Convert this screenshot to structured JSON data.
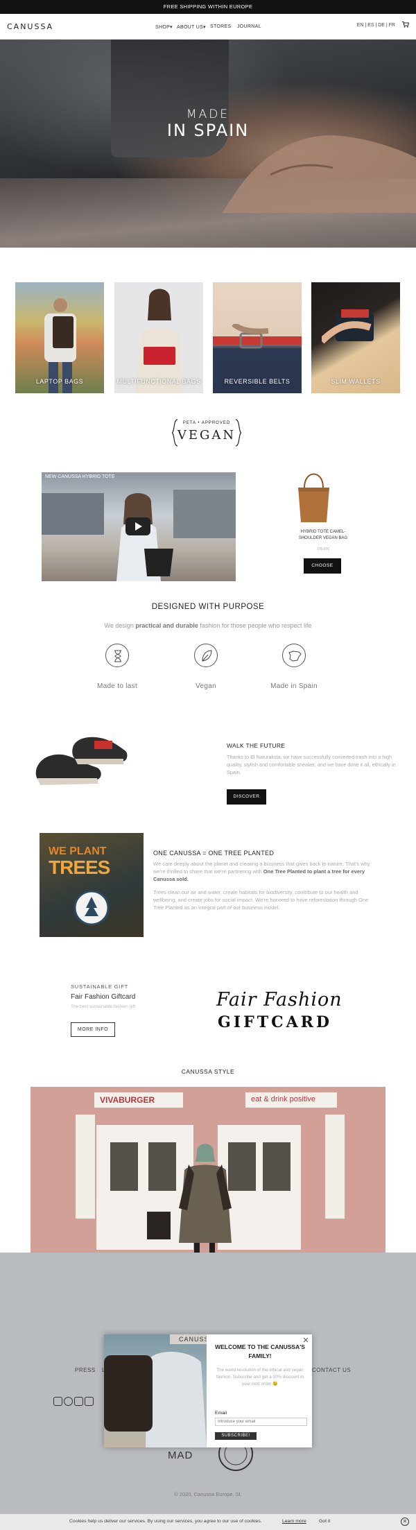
{
  "topbar": {
    "text": "FREE SHIPPING WITHIN EUROPE"
  },
  "header": {
    "logo": "CANUSSA",
    "nav": [
      "SHOP▾",
      "ABOUT US▾",
      "STORES",
      "JOURNAL"
    ],
    "languages": "EN | ES | DE | FR",
    "cart_icon": "cart-icon"
  },
  "hero": {
    "line1": "MADE",
    "line2": "IN SPAIN"
  },
  "categories": [
    {
      "label": "LAPTOP BAGS"
    },
    {
      "label": "MULTIFUNCTIONAL BAGS"
    },
    {
      "label": "REVERSIBLE BELTS"
    },
    {
      "label": "SLIM WALLETS"
    }
  ],
  "vegan_badge": {
    "small": "PETA • APPROVED",
    "big": "VEGAN"
  },
  "video": {
    "title": "NEW CANUSSA HYBRID TOTE"
  },
  "product": {
    "name": "HYBRID TOTE CAMEL-SHOULDER VEGAN BAG",
    "price": "105,00€",
    "button": "CHOOSE"
  },
  "purpose": {
    "title": "DESIGNED WITH PURPOSE",
    "subtitle_pre": "We design ",
    "subtitle_bold": "practical and durable",
    "subtitle_post": " fashion for those people who respect life",
    "features": [
      {
        "label": "Made to last",
        "icon": "hourglass-icon"
      },
      {
        "label": "Vegan",
        "icon": "leaf-icon"
      },
      {
        "label": "Made in Spain",
        "icon": "spain-map-icon"
      }
    ]
  },
  "walk": {
    "title": "WALK THE FUTURE",
    "text": "Thanks to El Naturalista, we have successfully converted trash into a high quality, stylish and comfortable sneaker, and we have done it all, ethically in Spain.",
    "button": "DISCOVER"
  },
  "trees": {
    "image_line1": "WE PLANT",
    "image_line2": "TREES",
    "title": "ONE CANUSSA = ONE TREE PLANTED",
    "text1_pre": "We care deeply about the planet and creating a business that gives back to nature. That's why we're thrilled to share that we're partnering with ",
    "text1_bold": "One Tree Planted to plant a tree for every Canussa sold.",
    "text2": "Trees clean our air and water, create habitats for biodiversity, contribute to our health and wellbeing, and create jobs for social impact. We're honored to have reforestation through One Tree Planted as an integral part of our business model."
  },
  "gift": {
    "tag": "SUSTAINABLE GIFT",
    "title": "Fair Fashion Giftcard",
    "subtitle": "The best sustainable fashion gift",
    "button": "MORE INFO",
    "script": "Fair Fashion",
    "card": "GIFTCARD"
  },
  "style": {
    "title": "CANUSSA STYLE",
    "sign1": "VIVABURGER",
    "sign2": "eat & drink positive"
  },
  "footer": {
    "links": [
      "PRESS",
      "L",
      "CONTACT US"
    ],
    "social_icons": [
      "instagram-icon",
      "facebook-icon",
      "youtube-icon",
      "linkedin-icon"
    ],
    "badge": "MAD",
    "copyright": "© 2020, Canussa Europe, SL"
  },
  "popup": {
    "title": "WELCOME TO THE CANUSSA'S FAMILY!",
    "text": "The world revolution of the ethical and vegan fashion. Subscribe and get a 10% discount in your next order 😉",
    "email_label": "Email",
    "email_placeholder": "Introduce your email",
    "button": "SUBSCRIBE!",
    "close": "✕",
    "image_brand": "CANUSSA"
  },
  "cookies": {
    "text": "Cookies help us deliver our services. By using our services, you agree to our use of cookies.",
    "more": "Learn more",
    "ok": "Got it",
    "close": "✕"
  },
  "colors": {
    "black": "#111111",
    "footer_bg": "#b8bbbf",
    "accent_orange": "#f1a53a"
  }
}
